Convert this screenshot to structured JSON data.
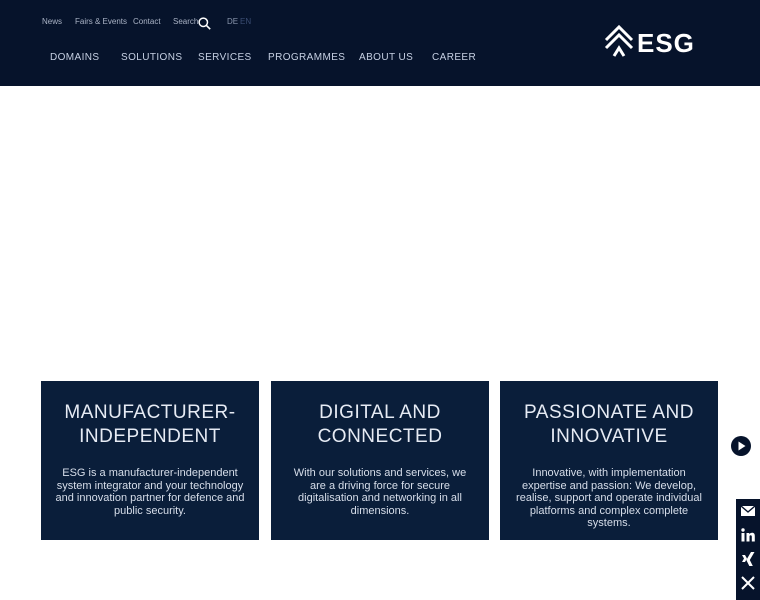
{
  "header": {
    "top_links": [
      "News",
      "Fairs & Events",
      "Contact",
      "Search"
    ],
    "lang": {
      "de": "DE",
      "en": "EN"
    },
    "nav": [
      "DOMAINS",
      "SOLUTIONS",
      "SERVICES",
      "PROGRAMMES",
      "ABOUT US",
      "CAREER"
    ],
    "logo_text": "ESG"
  },
  "cards": [
    {
      "title_line1": "MANUFACTURER-",
      "title_line2": "INDEPENDENT",
      "text": "ESG is a manufacturer-independent system integrator and your technology and innovation partner for defence and public security."
    },
    {
      "title_line1": "DIGITAL AND",
      "title_line2": "CONNECTED",
      "text": "With our solutions and services, we are a driving force for secure digitalisation and networking in all dimensions."
    },
    {
      "title_line1": "PASSIONATE AND",
      "title_line2": "INNOVATIVE",
      "text": "Innovative, with implementation expertise and passion: We develop, realise, support and operate individual platforms and complex complete systems."
    }
  ],
  "social": [
    "mail-icon",
    "linkedin-icon",
    "xing-icon",
    "x-icon"
  ],
  "colors": {
    "header_bg": "#06132b",
    "card_bg": "#0a1e3a",
    "nav_text": "#c6d0e3"
  }
}
